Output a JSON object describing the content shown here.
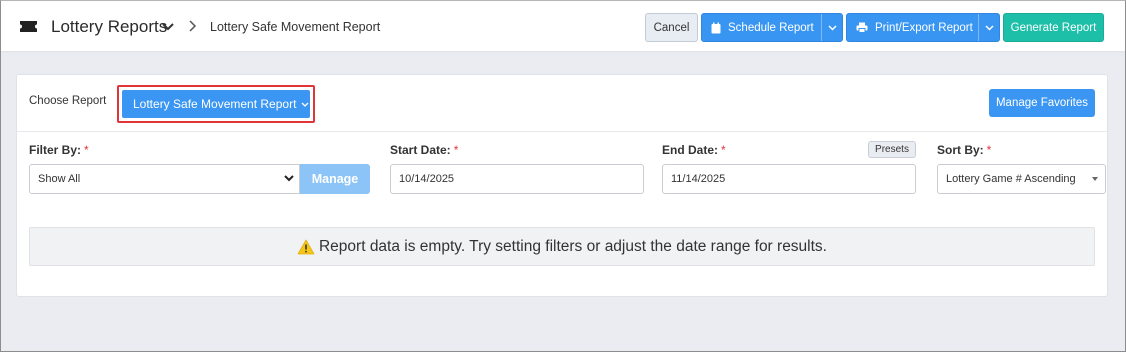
{
  "header": {
    "app_title": "Lottery Reports",
    "breadcrumb": "Lottery Safe Movement Report",
    "cancel_label": "Cancel",
    "schedule_label": "Schedule Report",
    "print_label": "Print/Export Report",
    "generate_label": "Generate Report"
  },
  "report": {
    "choose_label": "Choose Report",
    "selected_report": "Lottery Safe Movement Report",
    "manage_favorites_label": "Manage Favorites"
  },
  "filters": {
    "filter_by_label": "Filter By:",
    "filter_by_value": "Show All",
    "manage_label": "Manage",
    "start_date_label": "Start Date:",
    "start_date_value": "10/14/2025",
    "end_date_label": "End Date:",
    "end_date_value": "11/14/2025",
    "presets_label": "Presets",
    "sort_by_label": "Sort By:",
    "sort_by_value": "Lottery Game # Ascending",
    "required_mark": "*"
  },
  "message": {
    "empty_text": "Report data is empty. Try setting filters or adjust the date range for results."
  },
  "colors": {
    "primary": "#3a96f2",
    "teal": "#1dbfa8",
    "required": "#e0353a",
    "warning": "#f5c518"
  },
  "icons": [
    "ticket-icon",
    "chevron-down-icon",
    "chevron-right-icon",
    "calendar-icon",
    "printer-icon",
    "warning-icon"
  ]
}
